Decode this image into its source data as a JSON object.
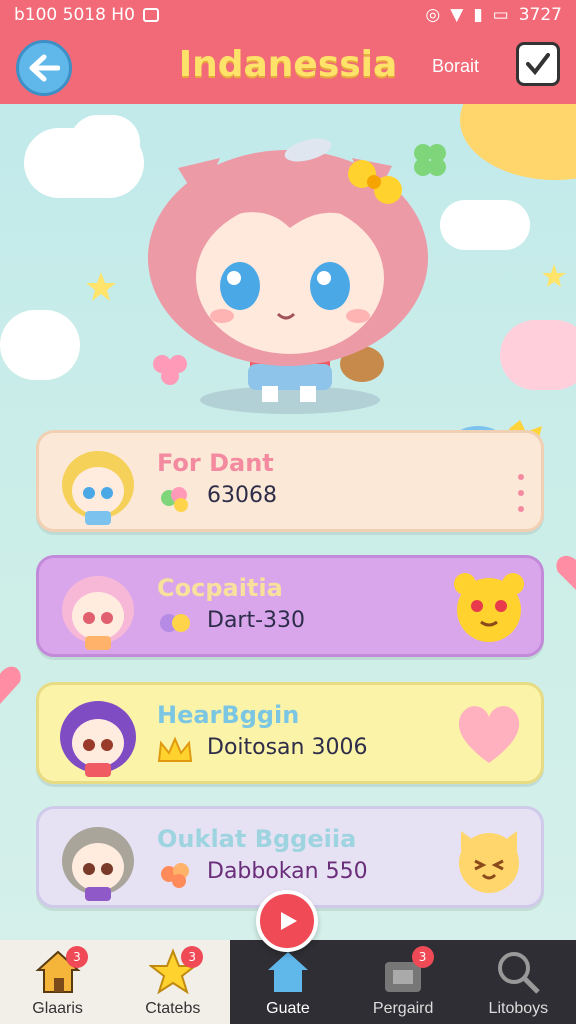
{
  "status_bar": {
    "left_text": "b100 5018 H0",
    "time": "3727"
  },
  "header": {
    "title": "Indanessia",
    "right_link": "Borait"
  },
  "cards": [
    {
      "name": "For Dant",
      "value": "63068"
    },
    {
      "name": "Cocpaitia",
      "value": "Dart-330"
    },
    {
      "name": "HearBggin",
      "value": "Doitosan 3006"
    },
    {
      "name": "Ouklat Bggeiia",
      "value": "Dabbokan 550"
    }
  ],
  "nav": [
    {
      "label": "Glaaris",
      "badge": "3"
    },
    {
      "label": "Ctatebs",
      "badge": "3"
    },
    {
      "label": "Guate",
      "badge": ""
    },
    {
      "label": "Pergaird",
      "badge": "3"
    },
    {
      "label": "Litoboys",
      "badge": ""
    }
  ],
  "colors": {
    "header": "#f26a78",
    "background": "#c8ece9",
    "card_peach": "#fbe8d6",
    "card_purple": "#d9a6ec",
    "card_yellow": "#fbf3a8",
    "card_lavender": "#e6e2f4",
    "play_button": "#ef4a56"
  }
}
